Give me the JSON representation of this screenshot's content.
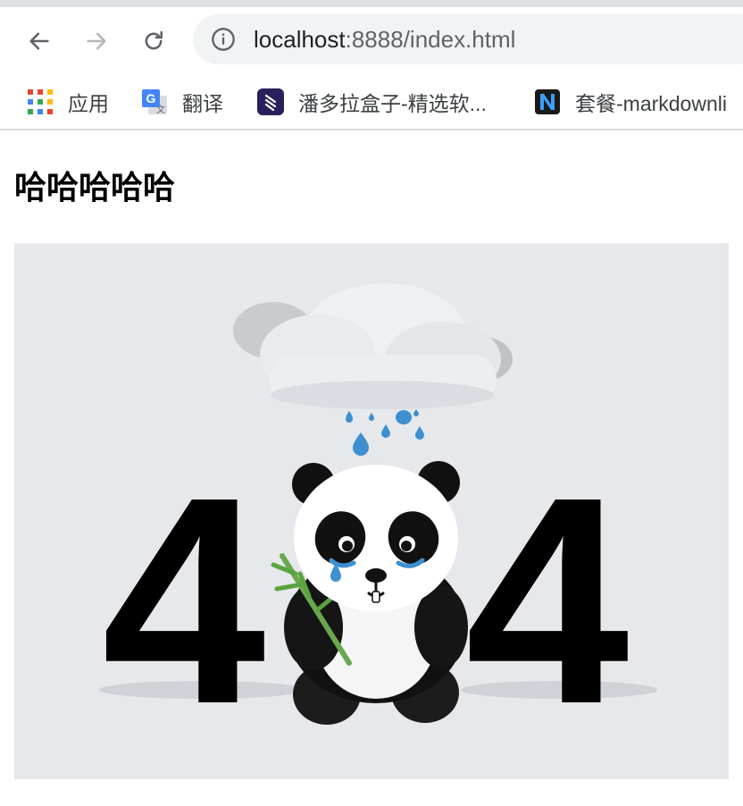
{
  "browser": {
    "address_bar": {
      "host": "localhost",
      "rest": ":8888/index.html"
    },
    "bookmarks": [
      {
        "label": "应用",
        "icon": "apps-grid-icon"
      },
      {
        "label": "翻译",
        "icon": "google-translate-icon"
      },
      {
        "label": "潘多拉盒子-精选软...",
        "icon": "pandora-box-icon"
      },
      {
        "label": "套餐-markdownli",
        "icon": "n-logo-icon"
      }
    ]
  },
  "page": {
    "heading": "哈哈哈哈哈",
    "image": {
      "left_digit": "4",
      "right_digit": "4",
      "background_color": "#e6e8ec"
    }
  }
}
